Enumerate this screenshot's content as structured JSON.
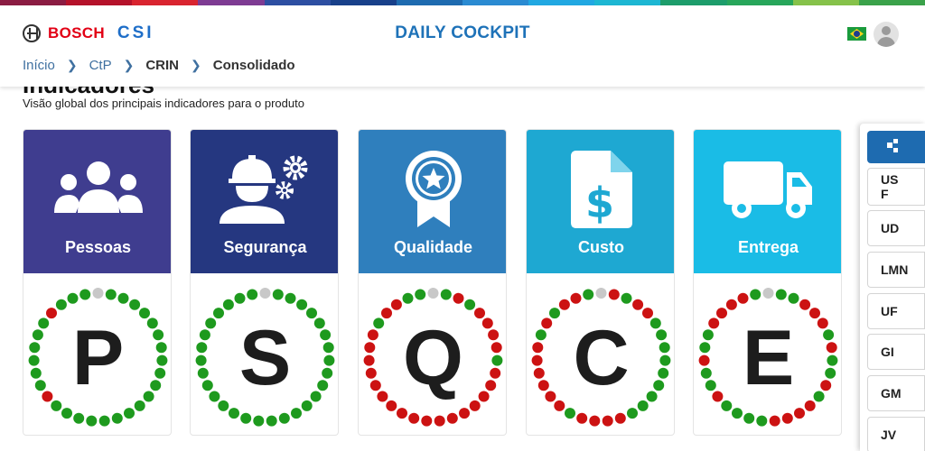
{
  "header": {
    "brand": "BOSCH",
    "sub_brand": "CSI",
    "app_title": "DAILY COCKPIT",
    "language_flag": "brazil-flag-icon",
    "top_stripe_colors": [
      "#8b1c42",
      "#b5122a",
      "#d9242f",
      "#7e3b93",
      "#2d4fa2",
      "#18408a",
      "#1e6bb0",
      "#2a8bd2",
      "#21a8e2",
      "#1db7d3",
      "#1d9d6b",
      "#27a65b",
      "#86c24a",
      "#3aa24a"
    ]
  },
  "breadcrumb": {
    "items": [
      {
        "label": "Início"
      },
      {
        "label": "CtP"
      },
      {
        "label": "CRIN"
      },
      {
        "label": "Consolidado"
      }
    ]
  },
  "section": {
    "title": "Indicadores",
    "subtitle": "Visão global dos principais indicadores para o produto"
  },
  "colors": {
    "green": "#1e9a1e",
    "red": "#cc1212",
    "gray": "#c8c8c8",
    "letter": "#1d1d1d"
  },
  "cards": [
    {
      "label": "Pessoas",
      "letter": "P",
      "icon": "people-group-icon",
      "color": "#3f3d8f",
      "dots": "gggggggggggggggggggrggggggrgggg"
    },
    {
      "label": "Segurança",
      "letter": "S",
      "icon": "worker-gears-icon",
      "color": "#253780",
      "dots": "gggggggggggggggggggggggggggggg"
    },
    {
      "label": "Qualidade",
      "letter": "Q",
      "icon": "award-ribbon-star-icon",
      "color": "#2f7fbd",
      "dots": "grgrrrrgrrrrrrrrrrrrrrrrrgrrgg"
    },
    {
      "label": "Custo",
      "letter": "C",
      "icon": "invoice-dollar-icon",
      "color": "#1ea8d2",
      "dots": "rgrrgggggggggrrrrgrrrrrrgrgrrg"
    },
    {
      "label": "Entrega",
      "letter": "E",
      "icon": "delivery-truck-icon",
      "color": "#1abce6",
      "dots": "ggrrrgrggrgrrrrggggrggrggrrrrg"
    }
  ],
  "sidebar": {
    "active_icon": "hierarchy-icon",
    "items": [
      {
        "label": "US F"
      },
      {
        "label": "UD"
      },
      {
        "label": "LMN"
      },
      {
        "label": "UF"
      },
      {
        "label": "GI"
      },
      {
        "label": "GM"
      },
      {
        "label": "JV"
      }
    ]
  }
}
